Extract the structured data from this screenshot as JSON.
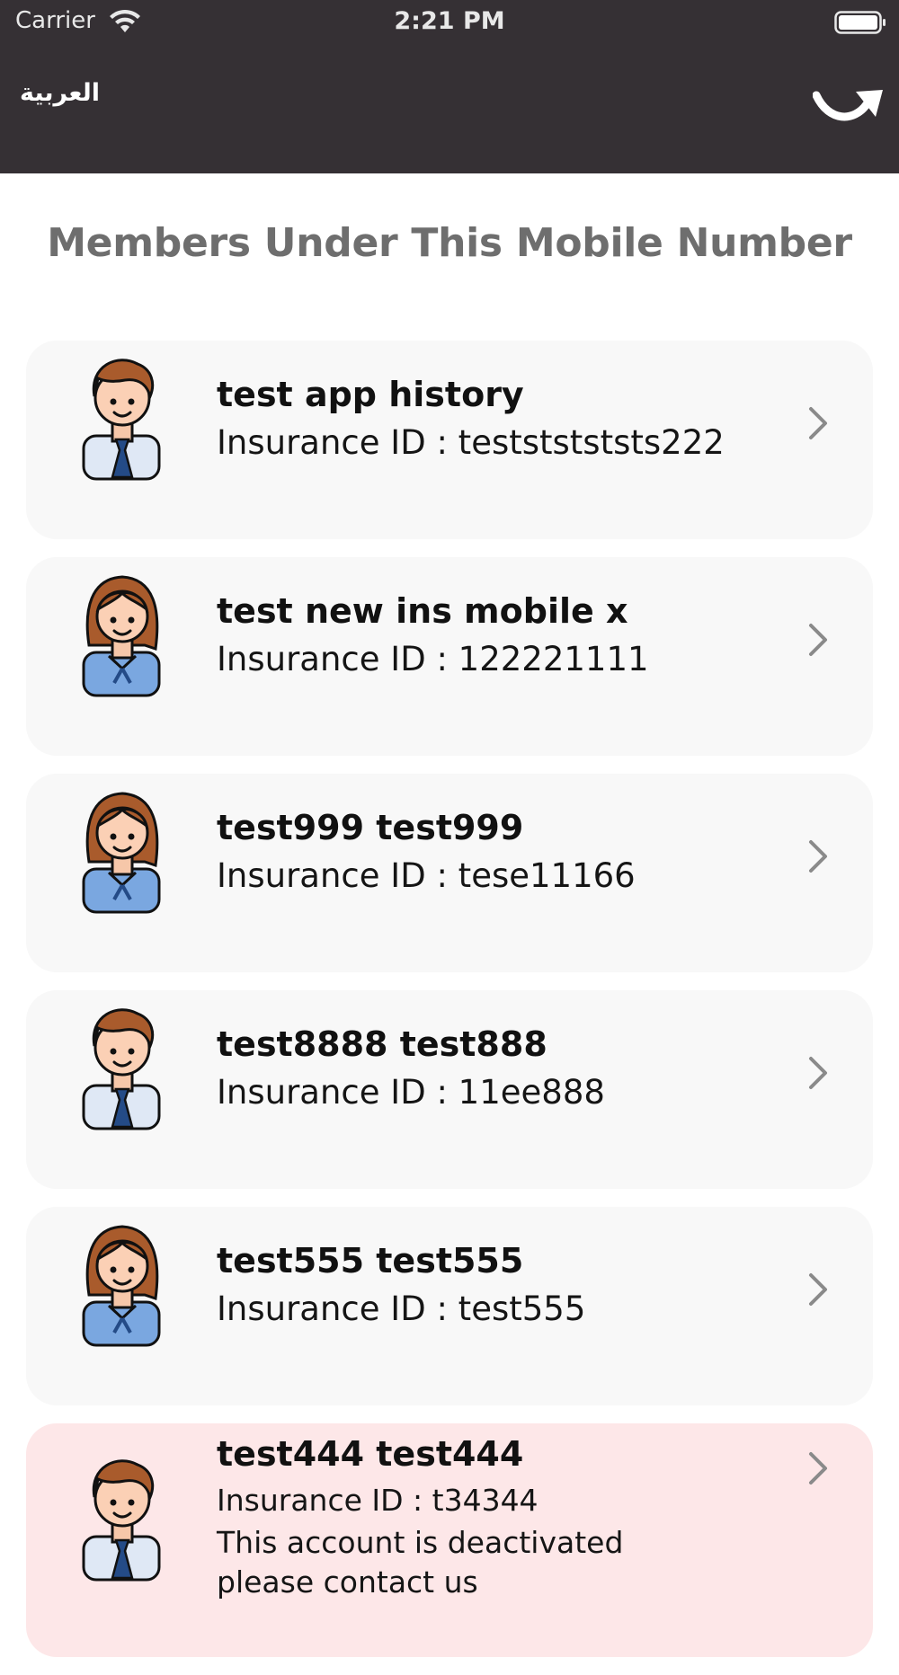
{
  "status_bar": {
    "carrier": "Carrier",
    "time": "2:21 PM"
  },
  "header": {
    "language_label": "العربية",
    "logout_icon": "logout-arrow-icon"
  },
  "page_title": "Members Under This Mobile Number",
  "colors": {
    "header_bg": "#353034",
    "card_bg": "#f8f8f8",
    "deactivated_bg": "#fde7e8",
    "title_text": "#6e6e6e"
  },
  "members": [
    {
      "name": "test app history",
      "insurance": "Insurance ID : testststststs222",
      "avatar": "male-avatar-icon"
    },
    {
      "name": "test new ins mobile x",
      "insurance": "Insurance ID : 122221111",
      "avatar": "female-avatar-icon"
    },
    {
      "name": "test999 test999",
      "insurance": "Insurance ID : tese11166",
      "avatar": "female-avatar-icon"
    },
    {
      "name": "test8888 test888",
      "insurance": "Insurance ID : 11ee888",
      "avatar": "male-avatar-icon"
    },
    {
      "name": "test555 test555",
      "insurance": "Insurance ID : test555",
      "avatar": "female-avatar-icon"
    },
    {
      "name": "test444 test444",
      "insurance": "Insurance ID : t34344",
      "avatar": "male-avatar-icon",
      "status_message": "This account is deactivated please contact us"
    }
  ]
}
